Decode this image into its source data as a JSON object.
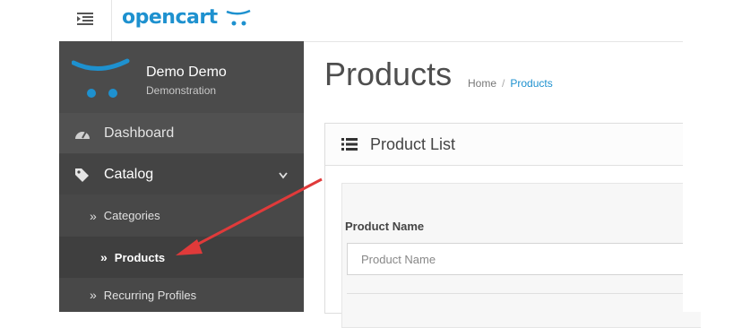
{
  "header": {
    "logo_text": "opencart",
    "menu_toggle_icon": "menu-indent-icon",
    "brand_color": "#1e91cf"
  },
  "profile": {
    "name": "Demo Demo",
    "role": "Demonstration"
  },
  "sidebar": {
    "items": [
      {
        "label": "Dashboard",
        "icon": "dashboard-icon"
      },
      {
        "label": "Catalog",
        "icon": "tags-icon",
        "expanded": true
      }
    ],
    "catalog_children": [
      {
        "label": "Categories"
      },
      {
        "label": "Products",
        "active": true
      },
      {
        "label": "Recurring Profiles"
      }
    ]
  },
  "page": {
    "title": "Products",
    "breadcrumb": [
      "Home",
      "Products"
    ]
  },
  "panel": {
    "title": "Product List",
    "filter": {
      "product_name_label": "Product Name",
      "product_name_placeholder": "Product Name"
    }
  },
  "annotation": {
    "arrow_color": "#e03a3a"
  }
}
